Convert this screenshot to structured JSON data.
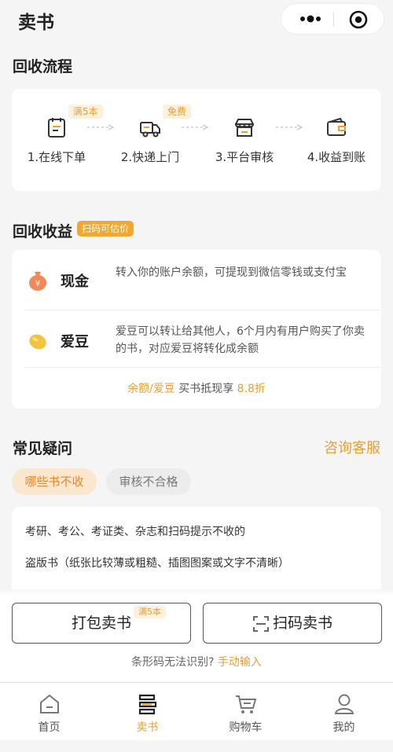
{
  "header": {
    "title": "卖书"
  },
  "process": {
    "title": "回收流程",
    "steps": [
      {
        "label": "1.在线下单",
        "tag": "满5本",
        "icon": "order-icon"
      },
      {
        "label": "2.快递上门",
        "tag": "免费",
        "icon": "delivery-truck-icon"
      },
      {
        "label": "3.平台审核",
        "tag": "",
        "icon": "store-icon"
      },
      {
        "label": "4.收益到账",
        "tag": "",
        "icon": "wallet-icon"
      }
    ]
  },
  "earnings": {
    "title": "回收收益",
    "badge": "扫码可估价",
    "items": [
      {
        "name": "现金",
        "desc": "转入你的账户余额，可提现到微信零钱或支付宝",
        "icon": "money-bag-icon"
      },
      {
        "name": "爱豆",
        "desc": "爱豆可以转让给其他人，6个月内有用户购买了你卖的书，对应爱豆将转化成余额",
        "icon": "bean-icon"
      }
    ],
    "footer": {
      "highlight": "余额/爱豆",
      "text": " 买书抵现享 ",
      "discount": "8.8折"
    }
  },
  "faq": {
    "title": "常见疑问",
    "service_link": "咨询客服",
    "tabs": [
      {
        "label": "哪些书不收"
      },
      {
        "label": "审核不合格"
      }
    ],
    "items": [
      "考研、考公、考证类、杂志和扫码提示不收的",
      "盗版书（纸张比较薄或粗糙、插图图案或文字不清晰）"
    ]
  },
  "actions": {
    "pack_button": "打包卖书",
    "pack_tag": "满5本",
    "scan_button": "扫码卖书",
    "barcode_hint": "条形码无法识别?",
    "manual_link": "手动输入"
  },
  "tabbar": {
    "items": [
      {
        "label": "首页",
        "icon": "home-icon"
      },
      {
        "label": "卖书",
        "icon": "sell-book-icon"
      },
      {
        "label": "购物车",
        "icon": "cart-icon"
      },
      {
        "label": "我的",
        "icon": "user-icon"
      }
    ],
    "active": "卖书"
  },
  "colors": {
    "accent": "#e8a033",
    "badge": "#f0a832",
    "tag_bg": "#fdf0dc"
  }
}
